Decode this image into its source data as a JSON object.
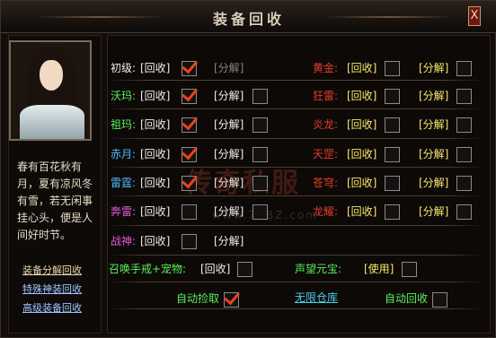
{
  "window": {
    "title": "装备回收",
    "close_label": "X"
  },
  "left": {
    "poem": "春有百花秋有月，夏有凉风冬有雪，若无闲事挂心头，便是人间好时节。",
    "links": [
      "装备分解回收",
      "特殊神装回收",
      "高级装备回收"
    ]
  },
  "left_rows": [
    {
      "label": "初级:",
      "color": "#f4ede0",
      "recycle": "[回收]",
      "recycle_checked": true,
      "decompose": "[分解]",
      "decompose_disabled": true,
      "decompose_checkbox": false
    },
    {
      "label": "沃玛:",
      "color": "#58f05a",
      "recycle": "[回收]",
      "recycle_checked": true,
      "decompose": "[分解]",
      "decompose_disabled": false,
      "decompose_checkbox": true
    },
    {
      "label": "祖玛:",
      "color": "#58f05a",
      "recycle": "[回收]",
      "recycle_checked": true,
      "decompose": "[分解]",
      "decompose_disabled": false,
      "decompose_checkbox": true
    },
    {
      "label": "赤月:",
      "color": "#4fb8ff",
      "recycle": "[回收]",
      "recycle_checked": true,
      "decompose": "[分解]",
      "decompose_disabled": false,
      "decompose_checkbox": true
    },
    {
      "label": "雷霆:",
      "color": "#4fb8ff",
      "recycle": "[回收]",
      "recycle_checked": true,
      "decompose": "[分解]",
      "decompose_disabled": false,
      "decompose_checkbox": true
    },
    {
      "label": "奔雷:",
      "color": "#e35ad8",
      "recycle": "[回收]",
      "recycle_checked": false,
      "decompose": "[分解]",
      "decompose_disabled": false,
      "decompose_checkbox": true
    },
    {
      "label": "战神:",
      "color": "#e35ad8",
      "recycle": "[回收]",
      "recycle_checked": false,
      "decompose": "[分解]",
      "decompose_disabled": false,
      "decompose_checkbox": false
    }
  ],
  "right_rows": [
    {
      "label": "黄金:",
      "recycle": "[回收]",
      "decompose": "[分解]"
    },
    {
      "label": "狂雷:",
      "recycle": "[回收]",
      "decompose": "[分解]"
    },
    {
      "label": "炎龙:",
      "recycle": "[回收]",
      "decompose": "[分解]"
    },
    {
      "label": "天罡:",
      "recycle": "[回收]",
      "decompose": "[分解]"
    },
    {
      "label": "苍穹:",
      "recycle": "[回收]",
      "decompose": "[分解]"
    },
    {
      "label": "龙耀:",
      "recycle": "[回收]",
      "decompose": "[分解]"
    }
  ],
  "extra": {
    "summon_label": "召唤手戒+宠物:",
    "summon_action": "[回收]",
    "prestige_label": "声望元宝:",
    "prestige_action": "[使用]",
    "auto_pickup": "自动捡取",
    "auto_pickup_checked": true,
    "warehouse": "无限仓库",
    "auto_recycle": "自动回收",
    "auto_recycle_checked": false
  },
  "watermark": {
    "main": "传奇私服",
    "sub": "www.7BBZ.com"
  },
  "colors": {
    "label_red": "#e43b2a",
    "action_yellow": "#f7e86a",
    "action_white": "#f2efe2",
    "check_red": "#e8421c",
    "green": "#58f05a",
    "cyan": "#49d0e8"
  }
}
